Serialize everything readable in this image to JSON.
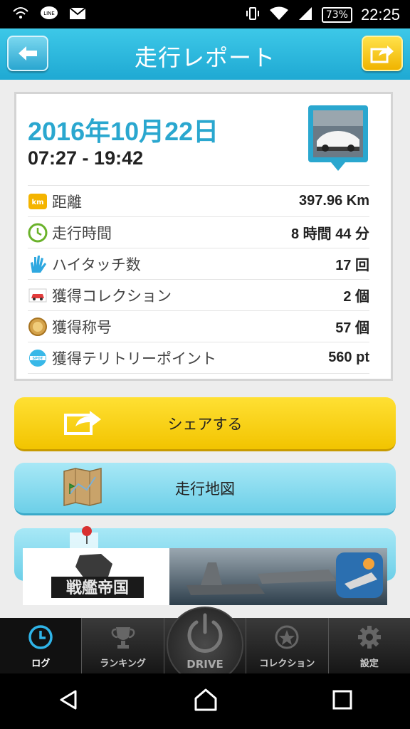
{
  "status_bar": {
    "left_icons": [
      "wifi-calling-icon",
      "line-app-icon",
      "gmail-icon"
    ],
    "battery": "73%",
    "time": "22:25"
  },
  "header": {
    "title": "走行レポート"
  },
  "report": {
    "date": "2016年10月22日",
    "time_range": "07:27 - 19:42",
    "rows": [
      {
        "icon": "km-icon",
        "label": "距離",
        "value": "397.96 Km"
      },
      {
        "icon": "clock-icon",
        "label": "走行時間",
        "value": "8 時間 44 分"
      },
      {
        "icon": "hand-icon",
        "label": "ハイタッチ数",
        "value": "17 回"
      },
      {
        "icon": "car-icon",
        "label": "獲得コレクション",
        "value": "2 個"
      },
      {
        "icon": "medal-icon",
        "label": "獲得称号",
        "value": "57 個"
      },
      {
        "icon": "spot-icon",
        "label": "獲得テリトリーポイント",
        "value": "560 pt"
      }
    ]
  },
  "actions": {
    "share_label": "シェアする",
    "map_label": "走行地図"
  },
  "ad": {
    "logo_text": "戦艦帝国"
  },
  "bottom_nav": [
    {
      "label": "ログ",
      "icon": "clock-icon",
      "active": true
    },
    {
      "label": "ランキング",
      "icon": "trophy-icon",
      "active": false
    },
    {
      "label": "DRIVE",
      "icon": "power-icon",
      "active": false
    },
    {
      "label": "コレクション",
      "icon": "star-icon",
      "active": false
    },
    {
      "label": "設定",
      "icon": "gear-icon",
      "active": false
    }
  ],
  "colors": {
    "header": "#1fa9d3",
    "date": "#2aa7cf",
    "share_button": "#f2c400",
    "map_button": "#6ccfe8"
  }
}
